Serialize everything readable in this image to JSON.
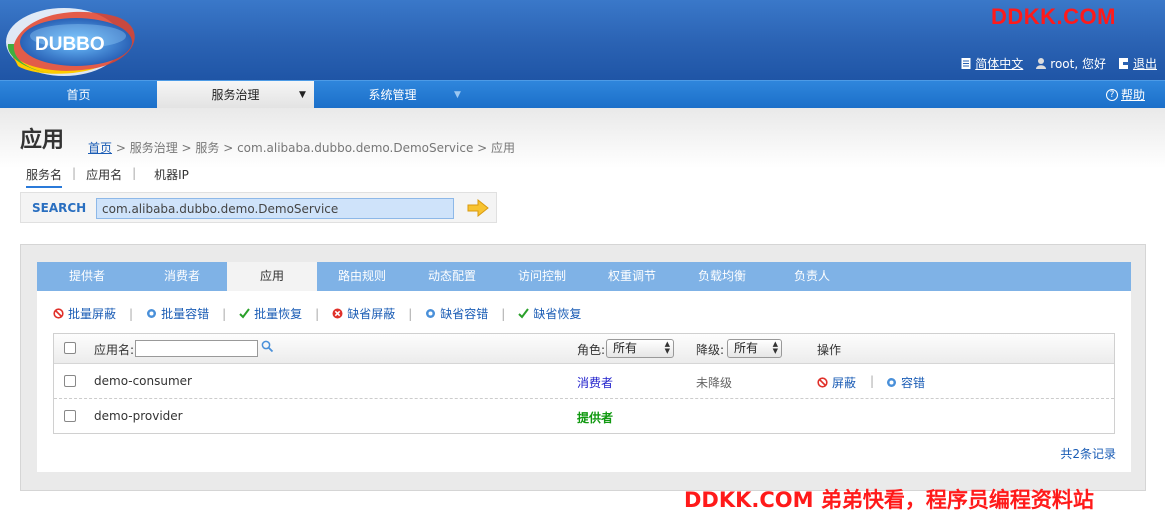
{
  "header": {
    "logo_text": "DUBBO",
    "watermark_top": "DDKK.COM",
    "links": {
      "language": "简体中文",
      "user": "root, 您好",
      "logout": "退出"
    }
  },
  "nav": {
    "items": [
      {
        "label": "首页"
      },
      {
        "label": "服务治理",
        "arrow": "▼"
      },
      {
        "label": "系统管理",
        "arrow": "▼"
      }
    ],
    "help": "帮助"
  },
  "page": {
    "title": "应用",
    "breadcrumb": {
      "home": "首页",
      "rest": " > 服务治理 > 服务 > com.alibaba.dubbo.demo.DemoService > 应用"
    }
  },
  "search": {
    "tabs": [
      "服务名",
      "应用名",
      "机器IP"
    ],
    "separator": "|",
    "label": "SEARCH",
    "value": "com.alibaba.dubbo.demo.DemoService"
  },
  "tabs": [
    "提供者",
    "消费者",
    "应用",
    "路由规则",
    "动态配置",
    "访问控制",
    "权重调节",
    "负载均衡",
    "负责人"
  ],
  "toolbar": {
    "batch_shield": "批量屏蔽",
    "batch_tolerate": "批量容错",
    "batch_recover": "批量恢复",
    "default_shield": "缺省屏蔽",
    "default_tolerate": "缺省容错",
    "default_recover": "缺省恢复",
    "separator": "|"
  },
  "grid": {
    "app_label": "应用名:",
    "role_label": "角色:",
    "role_selected": "所有",
    "degrade_label": "降级:",
    "degrade_selected": "所有",
    "op_label": "操作",
    "rows": [
      {
        "name": "demo-consumer",
        "role": "消费者",
        "degrade": "未降级",
        "op_shield": "屏蔽",
        "op_tolerate": "容错"
      },
      {
        "name": "demo-provider",
        "role": "提供者",
        "degrade": "",
        "op_shield": "",
        "op_tolerate": ""
      }
    ],
    "total": "共2条记录"
  },
  "watermark_bottom": "DDKK.COM 弟弟快看，程序员编程资料站",
  "colors": {
    "header_blue": "#2a62b3",
    "nav_blue": "#1b6fc9",
    "tab_bar": "#7fb2e6",
    "link": "#1a5cb5",
    "watermark": "#ff1a1a"
  }
}
